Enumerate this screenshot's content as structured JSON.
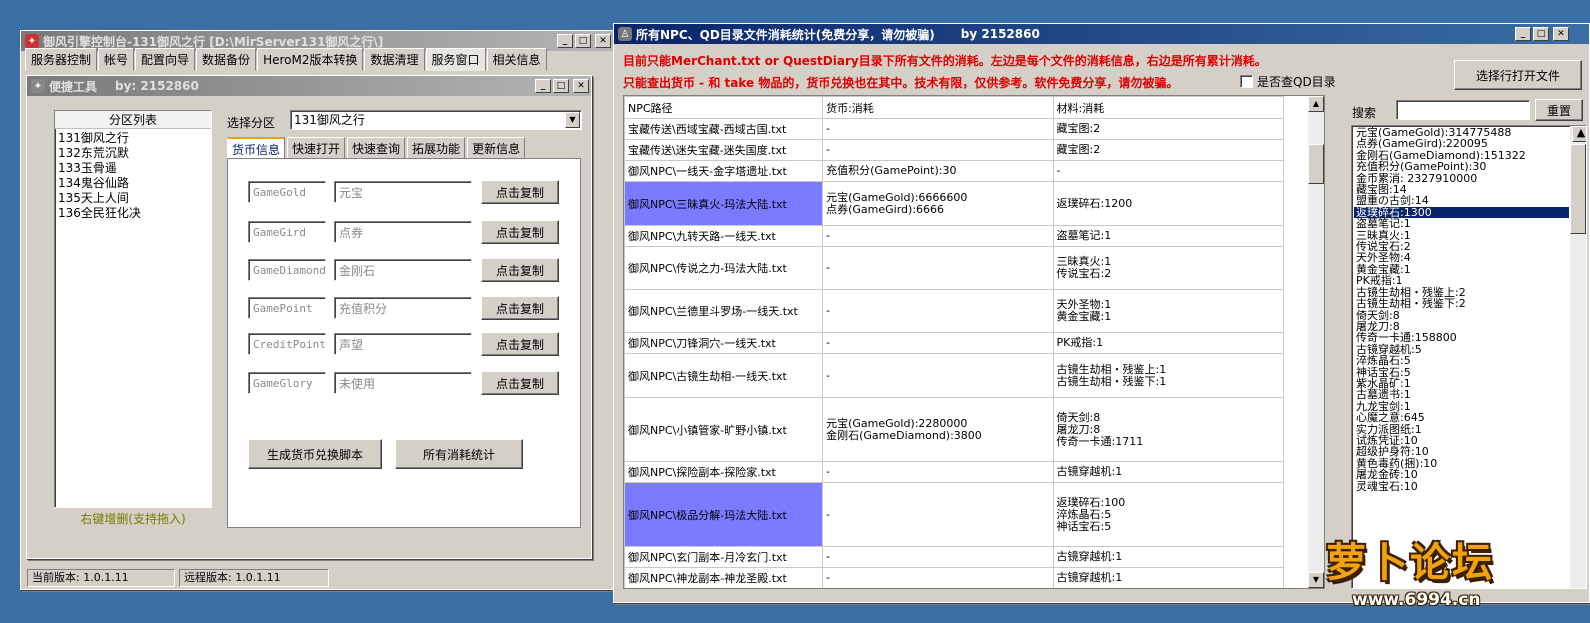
{
  "left_window": {
    "title": "御风引擎控制台-131御风之行 [D:\\MirServer131御风之行\\]",
    "tabs": [
      "服务器控制",
      "帐号",
      "配置向导",
      "数据备份",
      "HeroM2版本转换",
      "数据清理",
      "服务窗口",
      "相关信息"
    ],
    "active_tab": "服务窗口",
    "status_current": "当前版本: 1.0.1.11",
    "status_remote": "远程版本: 1.0.1.11"
  },
  "tool_window": {
    "title": "便捷工具",
    "author": "by: 2152860",
    "partition_header": "分区列表",
    "partitions": [
      "131御风之行",
      "132东荒沉默",
      "133玉骨遥",
      "134鬼谷仙路",
      "135天上人间",
      "136全民狂化决"
    ],
    "partition_footer": "右键增删(支持拖入)",
    "select_label": "选择分区",
    "select_value": "131御风之行",
    "subtabs": [
      "货币信息",
      "快速打开",
      "快速查询",
      "拓展功能",
      "更新信息"
    ],
    "currency_rows": [
      {
        "code": "GameGold",
        "name": "元宝",
        "btn": "点击复制"
      },
      {
        "code": "GameGird",
        "name": "点券",
        "btn": "点击复制"
      },
      {
        "code": "GameDiamond",
        "name": "金刚石",
        "btn": "点击复制"
      },
      {
        "code": "GamePoint",
        "name": "充值积分",
        "btn": "点击复制"
      },
      {
        "code": "CreditPoint",
        "name": "声望",
        "btn": "点击复制"
      },
      {
        "code": "GameGlory",
        "name": "未使用",
        "btn": "点击复制"
      }
    ],
    "btn_generate": "生成货币兑换脚本",
    "btn_stats": "所有消耗统计"
  },
  "right_window": {
    "title": "所有NPC、QD目录文件消耗统计(免费分享，请勿被骗)",
    "author": "by 2152860",
    "notice1": "目前只能MerChant.txt or QuestDiary目录下所有文件的消耗。左边是每个文件的消耗信息，右边是所有累计消耗。",
    "notice2": "只能查出货币 - 和 take 物品的，货币兑换也在其中。技术有限，仅供参考。软件免费分享，请勿被骗。",
    "checkbox_label": "是否查QD目录",
    "open_file_btn": "选择行打开文件",
    "search_label": "搜索",
    "reset_btn": "重置",
    "columns": [
      "NPC路径",
      "货币:消耗",
      "材料:消耗"
    ],
    "rows": [
      {
        "path": "宝藏传送\\西域宝藏-西域古国.txt",
        "currency": [
          "-"
        ],
        "material": [
          "藏宝图:2"
        ],
        "sel": false,
        "h": 21
      },
      {
        "path": "宝藏传送\\迷失宝藏-迷失国度.txt",
        "currency": [
          "-"
        ],
        "material": [
          "藏宝图:2"
        ],
        "sel": false,
        "h": 21
      },
      {
        "path": "御风NPC\\一线天-金字塔遗址.txt",
        "currency": [
          "充值积分(GamePoint):30"
        ],
        "material": [
          "-"
        ],
        "sel": false,
        "h": 21
      },
      {
        "path": "御风NPC\\三昧真火-玛法大陆.txt",
        "currency": [
          "元宝(GameGold):6666600",
          "点券(GameGird):6666"
        ],
        "material": [
          "返璞碎石:1200"
        ],
        "sel": true,
        "h": 44
      },
      {
        "path": "御风NPC\\九转天路-一线天.txt",
        "currency": [
          "-"
        ],
        "material": [
          "盗墓笔记:1"
        ],
        "sel": false,
        "h": 21
      },
      {
        "path": "御风NPC\\传说之力-玛法大陆.txt",
        "currency": [
          "-"
        ],
        "material": [
          "三昧真火:1",
          "传说宝石:2"
        ],
        "sel": false,
        "h": 43
      },
      {
        "path": "御风NPC\\兰德里斗罗场-一线天.txt",
        "currency": [
          "-"
        ],
        "material": [
          "天外圣物:1",
          "黄金宝藏:1"
        ],
        "sel": false,
        "h": 43
      },
      {
        "path": "御风NPC\\刀锋洞穴-一线天.txt",
        "currency": [
          "-"
        ],
        "material": [
          "PK戒指:1"
        ],
        "sel": false,
        "h": 21
      },
      {
        "path": "御风NPC\\古镜生劫相-一线天.txt",
        "currency": [
          "-"
        ],
        "material": [
          "古镜生劫相・残鉴上:1",
          "古镜生劫相・残鉴下:1"
        ],
        "sel": false,
        "h": 44
      },
      {
        "path": "御风NPC\\小镇管家-旷野小镇.txt",
        "currency": [
          "元宝(GameGold):2280000",
          "金刚石(GameDiamond):3800"
        ],
        "material": [
          "倚天剑:8",
          "屠龙刀:8",
          "传奇一卡通:1711"
        ],
        "sel": false,
        "h": 64
      },
      {
        "path": "御风NPC\\探险副本-探险家.txt",
        "currency": [
          "-"
        ],
        "material": [
          "古镜穿越机:1"
        ],
        "sel": false,
        "h": 21
      },
      {
        "path": "御风NPC\\极品分解-玛法大陆.txt",
        "currency": [
          "-"
        ],
        "material": [
          "返璞碎石:100",
          "淬炼晶石:5",
          "神话宝石:5"
        ],
        "sel": true,
        "h": 64
      },
      {
        "path": "御风NPC\\玄门副本-月冷玄门.txt",
        "currency": [
          "-"
        ],
        "material": [
          "古镜穿越机:1"
        ],
        "sel": false,
        "h": 21
      },
      {
        "path": "御风NPC\\神龙副本-神龙圣殿.txt",
        "currency": [
          "-"
        ],
        "material": [
          "古镜穿越机:1"
        ],
        "sel": false,
        "h": 21
      }
    ],
    "totals": [
      {
        "text": "元宝(GameGold):314775488",
        "sel": false
      },
      {
        "text": "点券(GameGird):220095",
        "sel": false
      },
      {
        "text": "金刚石(GameDiamond):151322",
        "sel": false
      },
      {
        "text": "充值积分(GamePoint):30",
        "sel": false
      },
      {
        "text": "金币累消: 2327910000",
        "sel": false
      },
      {
        "text": "藏宝图:14",
        "sel": false
      },
      {
        "text": "盟重の古剑:14",
        "sel": false
      },
      {
        "text": "返璞碎石:1300",
        "sel": true
      },
      {
        "text": "盗墓笔记:1",
        "sel": false
      },
      {
        "text": "三昧真火:1",
        "sel": false
      },
      {
        "text": "传说宝石:2",
        "sel": false
      },
      {
        "text": "天外圣物:4",
        "sel": false
      },
      {
        "text": "黄金宝藏:1",
        "sel": false
      },
      {
        "text": "PK戒指:1",
        "sel": false
      },
      {
        "text": "古镜生劫相・残鉴上:2",
        "sel": false
      },
      {
        "text": "古镜生劫相・残鉴下:2",
        "sel": false
      },
      {
        "text": "倚天剑:8",
        "sel": false
      },
      {
        "text": "屠龙刀:8",
        "sel": false
      },
      {
        "text": "传奇一卡通:158800",
        "sel": false
      },
      {
        "text": "古镜穿越机:5",
        "sel": false
      },
      {
        "text": "淬炼晶石:5",
        "sel": false
      },
      {
        "text": "神话宝石:5",
        "sel": false
      },
      {
        "text": "紫水晶矿:1",
        "sel": false
      },
      {
        "text": "古墓遗书:1",
        "sel": false
      },
      {
        "text": "九龙宝剑:1",
        "sel": false
      },
      {
        "text": "心魔之意:645",
        "sel": false
      },
      {
        "text": "实力派图纸:1",
        "sel": false
      },
      {
        "text": "试炼凭证:10",
        "sel": false
      },
      {
        "text": "超级护身符:10",
        "sel": false
      },
      {
        "text": "黄色毒药(捆):10",
        "sel": false
      },
      {
        "text": "屠龙金砖:10",
        "sel": false
      },
      {
        "text": "灵魂宝石:10",
        "sel": false
      }
    ]
  },
  "watermark": {
    "brand": "萝卜论坛",
    "url": "www.6994.cn"
  },
  "colors": {
    "accent": "#0a246a",
    "notice": "#e00000",
    "desktop": "#3a6ea5",
    "row_highlight": "#7b7bff"
  }
}
